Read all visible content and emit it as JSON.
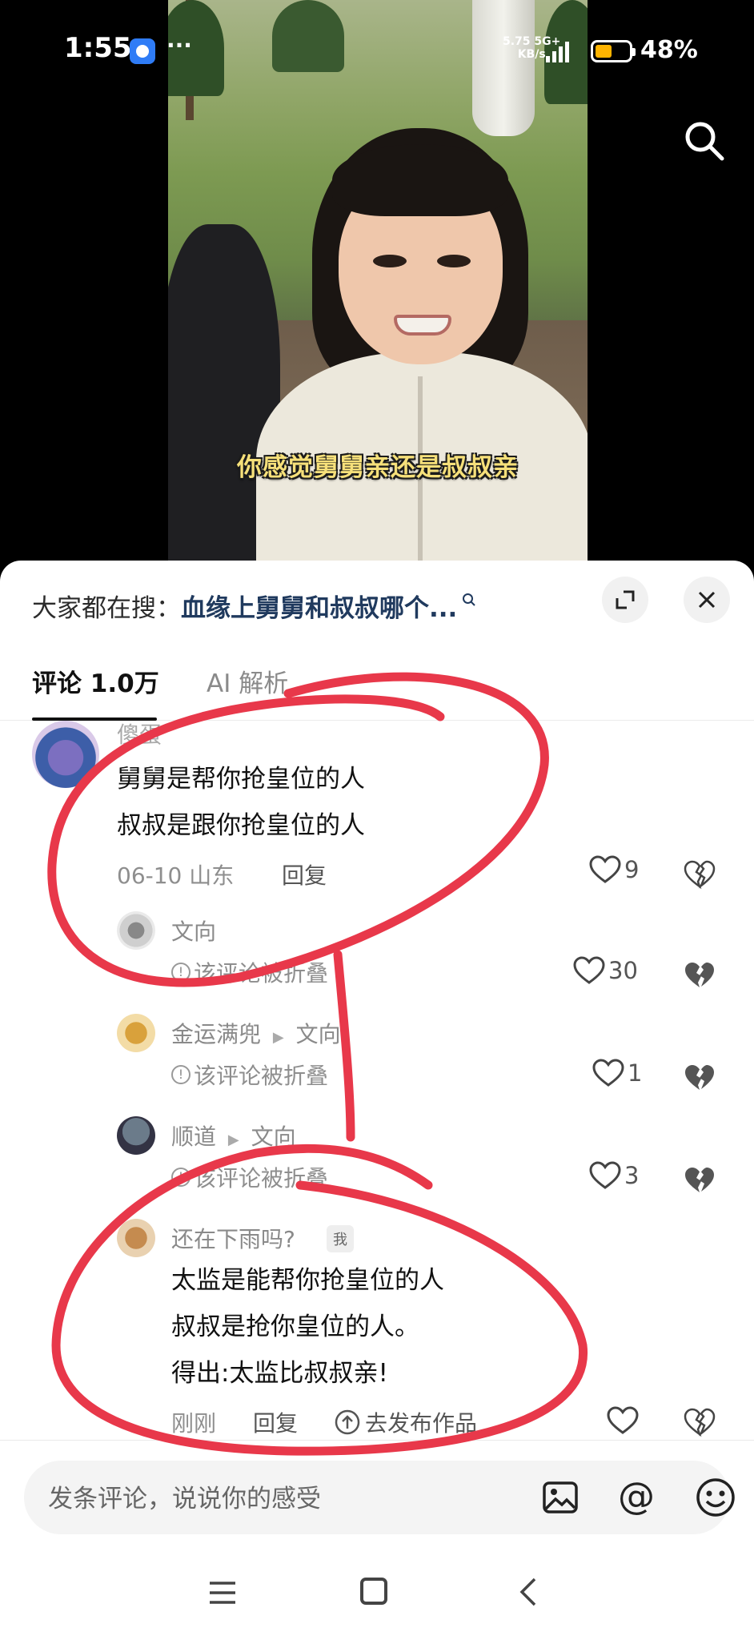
{
  "status_bar": {
    "time": "1:55",
    "dots": "···",
    "net_speed_top": "5.75 5G+",
    "net_speed_bottom": "KB/s",
    "battery": "48%"
  },
  "video": {
    "subtitle": "你感觉舅舅亲还是叔叔亲"
  },
  "search_hint": {
    "prefix": "大家都在搜：",
    "query": "血缘上舅舅和叔叔哪个..."
  },
  "tabs": {
    "comments": "评论 1.0万",
    "ai": "AI 解析"
  },
  "comments": [
    {
      "username": "傻蛋",
      "lines": [
        "舅舅是帮你抢皇位的人",
        "叔叔是跟你抢皇位的人"
      ],
      "date_location": "06-10  山东",
      "reply": "回复",
      "likes": "9"
    }
  ],
  "replies": [
    {
      "username": "文向",
      "folded": "该评论被折叠",
      "likes": "30"
    },
    {
      "username": "金运满兜",
      "reply_to": "文向",
      "folded": "该评论被折叠",
      "likes": "1"
    },
    {
      "username": "顺道",
      "reply_to": "文向",
      "folded": "该评论被折叠",
      "likes": "3"
    },
    {
      "username": "还在下雨吗?",
      "badge": "我",
      "lines": [
        "太监是能帮你抢皇位的人",
        "叔叔是抢你皇位的人。",
        "得出:太监比叔叔亲!"
      ],
      "time": "刚刚",
      "reply": "回复",
      "publish": "去发布作品"
    }
  ],
  "composer": {
    "placeholder": "发条评论，说说你的感受",
    "at": "@"
  },
  "colors": {
    "annotation_red": "#e8384a",
    "search_query": "#203a5e",
    "battery": "#ffb400"
  },
  "icons": [
    "search-icon",
    "expand-icon",
    "close-icon",
    "heart-icon",
    "broken-heart-icon",
    "image-icon",
    "emoji-icon",
    "menu-icon",
    "home-icon",
    "back-icon"
  ]
}
